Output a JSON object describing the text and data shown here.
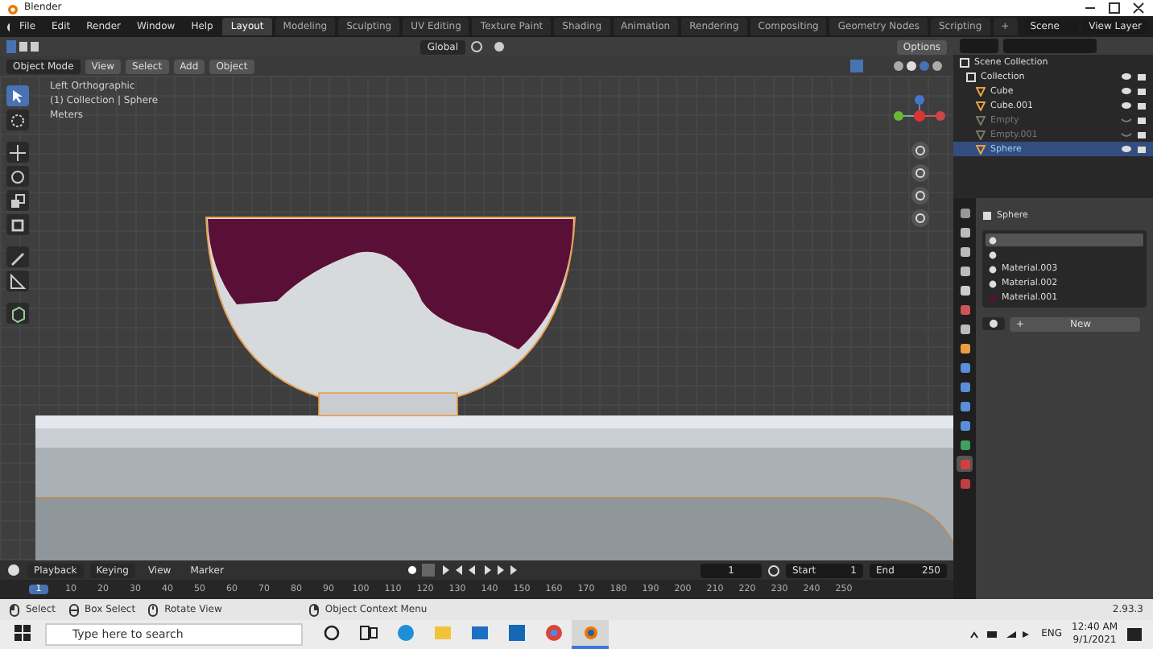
{
  "window": {
    "title": "Blender"
  },
  "menu": [
    "File",
    "Edit",
    "Render",
    "Window",
    "Help"
  ],
  "workspaces": [
    {
      "label": "Layout",
      "selected": true
    },
    {
      "label": "Modeling",
      "selected": false
    },
    {
      "label": "Sculpting",
      "selected": false
    },
    {
      "label": "UV Editing",
      "selected": false
    },
    {
      "label": "Texture Paint",
      "selected": false
    },
    {
      "label": "Shading",
      "selected": false
    },
    {
      "label": "Animation",
      "selected": false
    },
    {
      "label": "Rendering",
      "selected": false
    },
    {
      "label": "Compositing",
      "selected": false
    },
    {
      "label": "Geometry Nodes",
      "selected": false
    },
    {
      "label": "Scripting",
      "selected": false
    }
  ],
  "add_workspace": "+",
  "scene": "Scene",
  "view_layer": "View Layer",
  "tool_header": {
    "orientation": "Global",
    "options": "Options"
  },
  "viewport_header": {
    "mode": "Object Mode",
    "menus": [
      "View",
      "Select",
      "Add",
      "Object"
    ]
  },
  "viewport": {
    "lines": [
      "Left Orthographic",
      "(1) Collection | Sphere",
      "Meters"
    ]
  },
  "tools": [
    {
      "kind": "select",
      "selected": true
    },
    {
      "kind": "cursor",
      "selected": false
    },
    {
      "kind": "move",
      "selected": false
    },
    {
      "kind": "rotate",
      "selected": false
    },
    {
      "kind": "scale",
      "selected": false
    },
    {
      "kind": "transform",
      "selected": false
    },
    {
      "kind": "annotate",
      "selected": false
    },
    {
      "kind": "measure",
      "selected": false
    },
    {
      "kind": "add_cube",
      "selected": false
    }
  ],
  "outliner": {
    "root": "Scene Collection",
    "collection": "Collection",
    "items": [
      {
        "name": "Cube",
        "visible": true,
        "selected": false
      },
      {
        "name": "Cube.001",
        "visible": true,
        "selected": false
      },
      {
        "name": "Empty",
        "visible": false,
        "selected": false
      },
      {
        "name": "Empty.001",
        "visible": false,
        "selected": false
      },
      {
        "name": "Sphere",
        "visible": true,
        "selected": true
      }
    ]
  },
  "properties": {
    "object": "Sphere",
    "tabs": [
      {
        "kind": "tool",
        "selected": false
      },
      {
        "kind": "render",
        "selected": false
      },
      {
        "kind": "output",
        "selected": false
      },
      {
        "kind": "view_layer",
        "selected": false
      },
      {
        "kind": "scene",
        "selected": false
      },
      {
        "kind": "world",
        "selected": false
      },
      {
        "kind": "collection",
        "selected": false
      },
      {
        "kind": "object",
        "selected": false
      },
      {
        "kind": "modifiers",
        "selected": false
      },
      {
        "kind": "particles",
        "selected": false
      },
      {
        "kind": "physics",
        "selected": false
      },
      {
        "kind": "constraints",
        "selected": false
      },
      {
        "kind": "data",
        "selected": false
      },
      {
        "kind": "material",
        "selected": true
      },
      {
        "kind": "texture",
        "selected": false
      }
    ],
    "slots": [
      {
        "selected": true
      },
      {
        "selected": false
      },
      {
        "name": "Material.003",
        "selected": false
      },
      {
        "name": "Material.002",
        "selected": false
      },
      {
        "name": "Material.001",
        "selected": false
      }
    ],
    "new_button": "New",
    "plus": "+"
  },
  "timeline": {
    "menus": [
      "Playback",
      "Keying"
    ],
    "plain_menus": [
      "View",
      "Marker"
    ],
    "frame": "1",
    "start_label": "Start",
    "start": "1",
    "end_label": "End",
    "end": "250",
    "ticks": [
      {
        "label": "1",
        "selected": true
      },
      {
        "label": "10",
        "selected": false
      },
      {
        "label": "20",
        "selected": false
      },
      {
        "label": "30",
        "selected": false
      },
      {
        "label": "40",
        "selected": false
      },
      {
        "label": "50",
        "selected": false
      },
      {
        "label": "60",
        "selected": false
      },
      {
        "label": "70",
        "selected": false
      },
      {
        "label": "80",
        "selected": false
      },
      {
        "label": "90",
        "selected": false
      },
      {
        "label": "100",
        "selected": false
      },
      {
        "label": "110",
        "selected": false
      },
      {
        "label": "120",
        "selected": false
      },
      {
        "label": "130",
        "selected": false
      },
      {
        "label": "140",
        "selected": false
      },
      {
        "label": "150",
        "selected": false
      },
      {
        "label": "160",
        "selected": false
      },
      {
        "label": "170",
        "selected": false
      },
      {
        "label": "180",
        "selected": false
      },
      {
        "label": "190",
        "selected": false
      },
      {
        "label": "200",
        "selected": false
      },
      {
        "label": "210",
        "selected": false
      },
      {
        "label": "220",
        "selected": false
      },
      {
        "label": "230",
        "selected": false
      },
      {
        "label": "240",
        "selected": false
      },
      {
        "label": "250",
        "selected": false
      }
    ]
  },
  "status_bar": {
    "hints": [
      {
        "kind": "left",
        "label": "Select"
      },
      {
        "kind": "drag",
        "label": "Box Select"
      },
      {
        "kind": "middle",
        "label": "Rotate View"
      },
      {
        "kind": "right",
        "label": "Object Context Menu"
      }
    ],
    "version": "2.93.3"
  },
  "taskbar": {
    "search": {
      "placeholder": "Type here to search"
    },
    "apps": [
      {
        "kind": "cortana",
        "selected": false
      },
      {
        "kind": "taskview",
        "selected": false
      },
      {
        "kind": "edge",
        "selected": false
      },
      {
        "kind": "explorer",
        "selected": false
      },
      {
        "kind": "mail",
        "selected": false
      },
      {
        "kind": "app",
        "selected": false
      },
      {
        "kind": "chrome",
        "selected": false
      },
      {
        "kind": "blender",
        "selected": true
      }
    ],
    "language": "ENG",
    "time": "12:40 AM",
    "date": "9/1/2021"
  }
}
